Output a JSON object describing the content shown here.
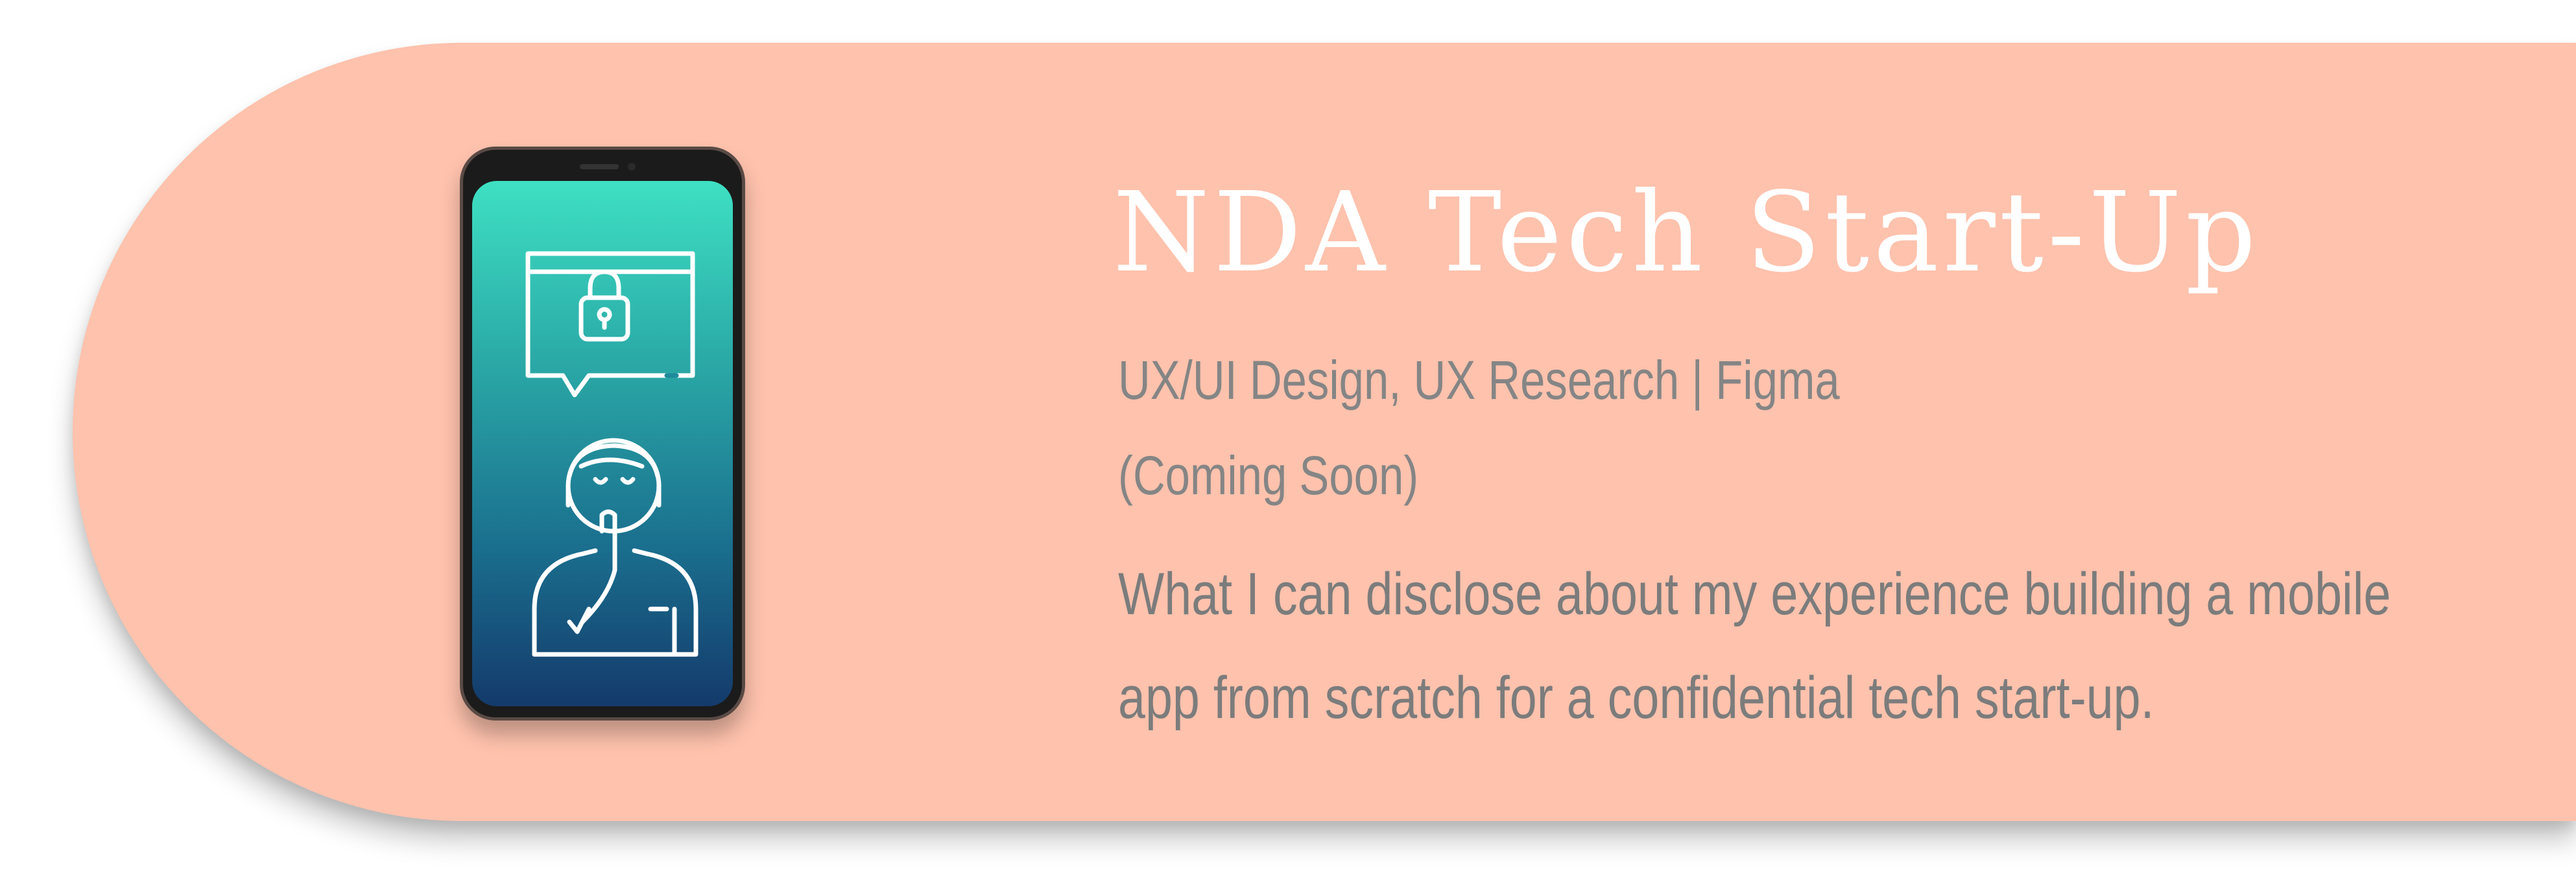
{
  "project": {
    "title": "NDA Tech Start-Up",
    "skills": "UX/UI Design, UX Research | Figma",
    "status": "(Coming Soon)",
    "description": "What I can disclose about my experience building a mobile app from scratch for a confidential tech start-up."
  },
  "icons": {
    "device": "smartphone-icon",
    "lock": "lock-icon",
    "chat": "speech-bubble-icon",
    "person": "person-shushing-icon"
  },
  "colors": {
    "card_background": "#fec2ad",
    "title": "#ffffff",
    "subtitle": "#858585",
    "description": "#7c7c7c",
    "screen_gradient_top": "#3ee0c3",
    "screen_gradient_bottom": "#143a6b"
  }
}
